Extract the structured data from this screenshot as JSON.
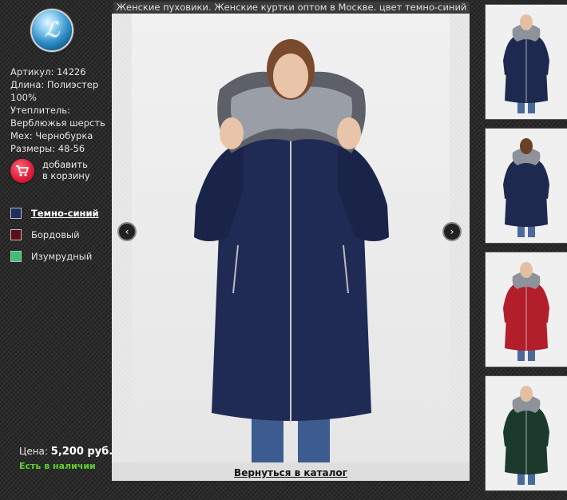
{
  "header": {
    "title": "Женские пуховики. Женские куртки оптом в Москве. цвет темно-синий"
  },
  "product": {
    "specs": [
      "Артикул: 14226",
      "Длина: Полиэстер",
      "100%",
      "Утеплитель:",
      "Верблюжья шерсть",
      "Мех: Чернобурка",
      "Размеры: 48-56"
    ],
    "cart": {
      "line1": "добавить",
      "line2": "в корзину"
    },
    "price_label": "Цена:",
    "price_value": "5,200 руб.",
    "stock": "Есть в наличии"
  },
  "colors": [
    {
      "label": "Темно-синий",
      "swatch": "#1c2d5e",
      "active": true
    },
    {
      "label": "Бордовый",
      "swatch": "#5a0d18",
      "active": false
    },
    {
      "label": "Изумрудный",
      "swatch": "#3fbf72",
      "active": false
    }
  ],
  "nav": {
    "prev_icon": "chevron-left-icon",
    "next_icon": "chevron-right-icon"
  },
  "footer": {
    "back_link": "Вернуться в каталог"
  },
  "thumbnails": [
    {
      "coat_color": "#1e2950",
      "view": "front"
    },
    {
      "coat_color": "#1e2950",
      "view": "back"
    },
    {
      "coat_color": "#b21e2a",
      "view": "front"
    },
    {
      "coat_color": "#1c3a2c",
      "view": "front"
    }
  ]
}
